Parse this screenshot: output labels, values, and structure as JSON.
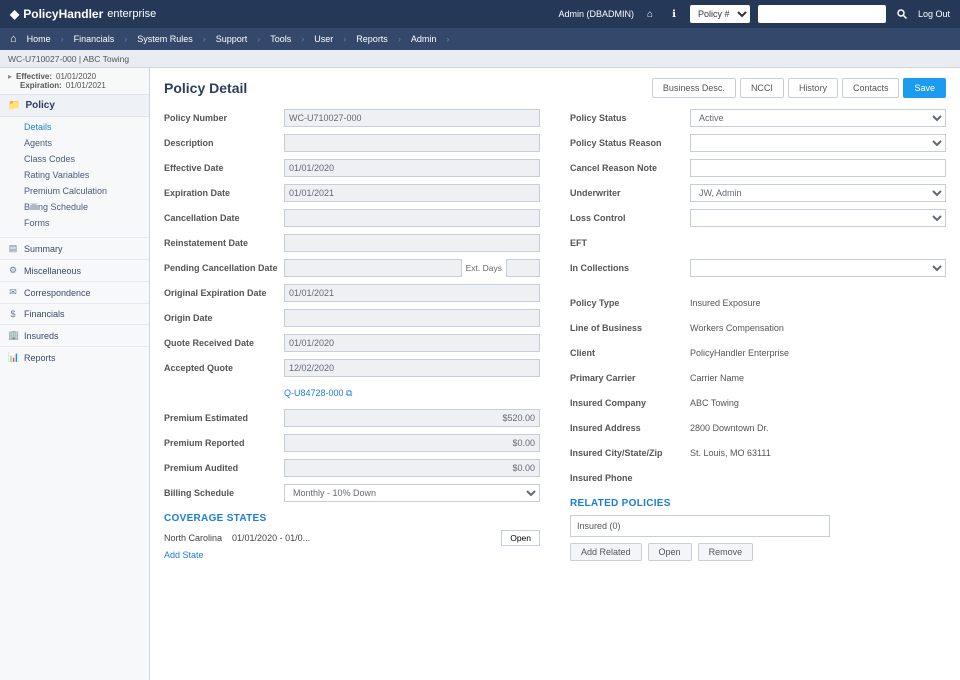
{
  "topbar": {
    "brand_main": "PolicyHandler",
    "brand_sub": "enterprise",
    "admin_label": "Admin (DBADMIN)",
    "policy_dropdown": "Policy #",
    "search_placeholder": "",
    "logout": "Log Out"
  },
  "nav": {
    "items": [
      "Home",
      "Financials",
      "System Rules",
      "Support",
      "Tools",
      "User",
      "Reports",
      "Admin"
    ]
  },
  "crumb": "WC-U710027-000 | ABC Towing",
  "sidebar": {
    "eff_label": "Effective:",
    "eff_value": "01/01/2020",
    "exp_label": "Expiration:",
    "exp_value": "01/01/2021",
    "policy_head": "Policy",
    "items": [
      "Details",
      "Agents",
      "Class Codes",
      "Rating Variables",
      "Premium Calculation",
      "Billing Schedule",
      "Forms"
    ],
    "groups": [
      "Summary",
      "Miscellaneous",
      "Correspondence",
      "Financials",
      "Insureds",
      "Reports"
    ]
  },
  "detail": {
    "title": "Policy Detail",
    "btn_business": "Business Desc.",
    "btn_ncci": "NCCI",
    "btn_history": "History",
    "btn_contacts": "Contacts",
    "btn_save": "Save",
    "left": {
      "policy_number_label": "Policy Number",
      "policy_number_value": "WC-U710027-000",
      "description_label": "Description",
      "description_value": "",
      "effective_date_label": "Effective Date",
      "effective_date_value": "01/01/2020",
      "expiration_date_label": "Expiration Date",
      "expiration_date_value": "01/01/2021",
      "cancellation_date_label": "Cancellation Date",
      "cancellation_date_value": "",
      "reinstatement_date_label": "Reinstatement Date",
      "reinstatement_date_value": "",
      "pending_cancel_label": "Pending Cancellation Date",
      "pending_cancel_value": "",
      "ext_label": "Ext. Days",
      "original_exp_label": "Original Expiration Date",
      "original_exp_value": "01/01/2021",
      "origin_date_label": "Origin Date",
      "origin_date_value": "",
      "quote_received_label": "Quote Received Date",
      "quote_received_value": "01/01/2020",
      "accepted_quote_label": "Accepted Quote",
      "accepted_quote_value": "12/02/2020",
      "quote_link": "Q-U84728-000 ⧉",
      "premium_estimated_label": "Premium Estimated",
      "premium_estimated_value": "$520.00",
      "premium_reported_label": "Premium Reported",
      "premium_reported_value": "$0.00",
      "premium_audited_label": "Premium Audited",
      "premium_audited_value": "$0.00",
      "billing_schedule_label": "Billing Schedule",
      "billing_schedule_value": "Monthly - 10% Down"
    },
    "right": {
      "policy_status_label": "Policy Status",
      "policy_status_value": "Active",
      "status_reason_label": "Policy Status Reason",
      "cancel_reason_label": "Cancel Reason Note",
      "underwriter_label": "Underwriter",
      "underwriter_value": "JW, Admin",
      "loss_control_label": "Loss Control",
      "eft_label": "EFT",
      "in_collections_label": "In Collections",
      "policy_type_label": "Policy Type",
      "policy_type_value": "Insured Exposure",
      "lob_label": "Line of Business",
      "lob_value": "Workers Compensation",
      "client_label": "Client",
      "client_value": "PolicyHandler Enterprise",
      "primary_carrier_label": "Primary Carrier",
      "primary_carrier_value": "Carrier Name",
      "insured_company_label": "Insured Company",
      "insured_company_value": "ABC Towing",
      "insured_address_label": "Insured Address",
      "insured_address_value": "2800 Downtown Dr.",
      "insured_csz_label": "Insured City/State/Zip",
      "insured_csz_value": "St. Louis, MO 63111",
      "insured_phone_label": "Insured Phone"
    },
    "coverage_header": "COVERAGE STATES",
    "coverage_state": "North Carolina",
    "coverage_dates": "01/01/2020 - 01/0...",
    "coverage_open": "Open",
    "add_state": "Add State",
    "related_header": "RELATED POLICIES",
    "related_entry": "Insured (0)",
    "rel_add": "Add Related",
    "rel_open": "Open",
    "rel_remove": "Remove"
  }
}
